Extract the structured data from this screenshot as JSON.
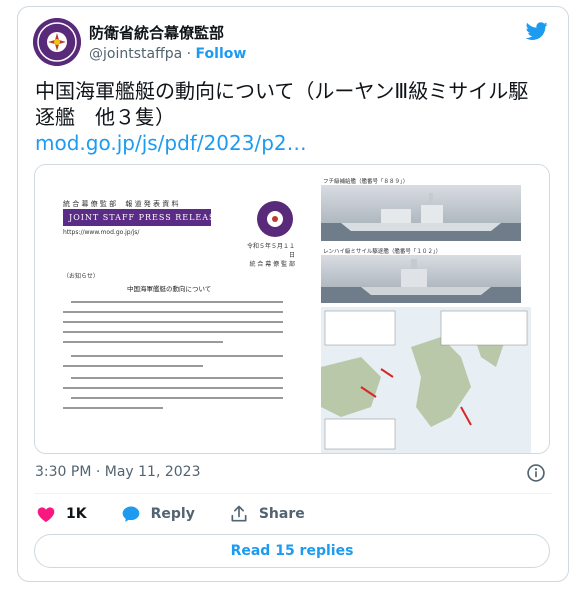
{
  "account": {
    "display_name": "防衛省統合幕僚監部",
    "handle": "@jointstaffpa",
    "separator": "·",
    "follow_label": "Follow",
    "avatar_icon": "jsdf-emblem"
  },
  "tweet": {
    "text": "中国海軍艦艇の動向について（ルーヤンⅢ級ミサイル駆逐艦　他３隻）",
    "link": "mod.go.jp/js/pdf/2023/p2…"
  },
  "media": {
    "doc_org": "統 合 幕 僚 監 部　 報 道 発 表 資 料",
    "doc_banner": "JOINT STAFF PRESS RELEASE",
    "doc_url": "https://www.mod.go.jp/js/",
    "doc_date_line1": "令和５年５月１１日",
    "doc_date_line2": "統 合 幕 僚 監 部",
    "doc_notice": "（お知らせ）",
    "doc_heading": "中国海軍艦艇の動向について",
    "photo1_caption": "フチ級補給艦（艦番号「８８９」）",
    "photo2_caption": "レンハイ級ミサイル駆逐艦（艦番号「１０２」）"
  },
  "timestamp": "3:30 PM · May 11, 2023",
  "actions": {
    "like_count": "1K",
    "reply_label": "Reply",
    "share_label": "Share"
  },
  "read_replies_label": "Read 15 replies",
  "colors": {
    "accent": "#1d9bf0",
    "like": "#f91880",
    "banner": "#5b2c86"
  }
}
